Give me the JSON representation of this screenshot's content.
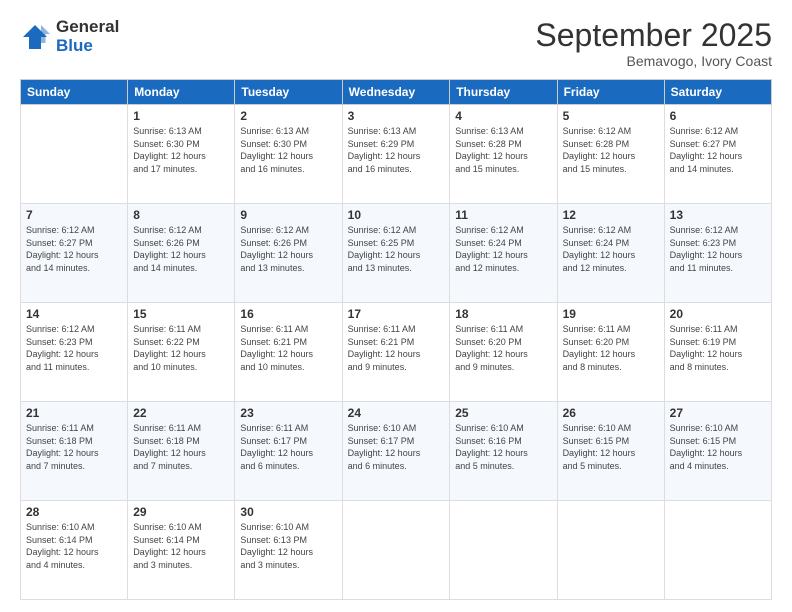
{
  "logo": {
    "general": "General",
    "blue": "Blue"
  },
  "title": "September 2025",
  "subtitle": "Bemavogo, Ivory Coast",
  "days_of_week": [
    "Sunday",
    "Monday",
    "Tuesday",
    "Wednesday",
    "Thursday",
    "Friday",
    "Saturday"
  ],
  "weeks": [
    [
      {
        "day": "",
        "info": ""
      },
      {
        "day": "1",
        "info": "Sunrise: 6:13 AM\nSunset: 6:30 PM\nDaylight: 12 hours\nand 17 minutes."
      },
      {
        "day": "2",
        "info": "Sunrise: 6:13 AM\nSunset: 6:30 PM\nDaylight: 12 hours\nand 16 minutes."
      },
      {
        "day": "3",
        "info": "Sunrise: 6:13 AM\nSunset: 6:29 PM\nDaylight: 12 hours\nand 16 minutes."
      },
      {
        "day": "4",
        "info": "Sunrise: 6:13 AM\nSunset: 6:28 PM\nDaylight: 12 hours\nand 15 minutes."
      },
      {
        "day": "5",
        "info": "Sunrise: 6:12 AM\nSunset: 6:28 PM\nDaylight: 12 hours\nand 15 minutes."
      },
      {
        "day": "6",
        "info": "Sunrise: 6:12 AM\nSunset: 6:27 PM\nDaylight: 12 hours\nand 14 minutes."
      }
    ],
    [
      {
        "day": "7",
        "info": "Sunrise: 6:12 AM\nSunset: 6:27 PM\nDaylight: 12 hours\nand 14 minutes."
      },
      {
        "day": "8",
        "info": "Sunrise: 6:12 AM\nSunset: 6:26 PM\nDaylight: 12 hours\nand 14 minutes."
      },
      {
        "day": "9",
        "info": "Sunrise: 6:12 AM\nSunset: 6:26 PM\nDaylight: 12 hours\nand 13 minutes."
      },
      {
        "day": "10",
        "info": "Sunrise: 6:12 AM\nSunset: 6:25 PM\nDaylight: 12 hours\nand 13 minutes."
      },
      {
        "day": "11",
        "info": "Sunrise: 6:12 AM\nSunset: 6:24 PM\nDaylight: 12 hours\nand 12 minutes."
      },
      {
        "day": "12",
        "info": "Sunrise: 6:12 AM\nSunset: 6:24 PM\nDaylight: 12 hours\nand 12 minutes."
      },
      {
        "day": "13",
        "info": "Sunrise: 6:12 AM\nSunset: 6:23 PM\nDaylight: 12 hours\nand 11 minutes."
      }
    ],
    [
      {
        "day": "14",
        "info": "Sunrise: 6:12 AM\nSunset: 6:23 PM\nDaylight: 12 hours\nand 11 minutes."
      },
      {
        "day": "15",
        "info": "Sunrise: 6:11 AM\nSunset: 6:22 PM\nDaylight: 12 hours\nand 10 minutes."
      },
      {
        "day": "16",
        "info": "Sunrise: 6:11 AM\nSunset: 6:21 PM\nDaylight: 12 hours\nand 10 minutes."
      },
      {
        "day": "17",
        "info": "Sunrise: 6:11 AM\nSunset: 6:21 PM\nDaylight: 12 hours\nand 9 minutes."
      },
      {
        "day": "18",
        "info": "Sunrise: 6:11 AM\nSunset: 6:20 PM\nDaylight: 12 hours\nand 9 minutes."
      },
      {
        "day": "19",
        "info": "Sunrise: 6:11 AM\nSunset: 6:20 PM\nDaylight: 12 hours\nand 8 minutes."
      },
      {
        "day": "20",
        "info": "Sunrise: 6:11 AM\nSunset: 6:19 PM\nDaylight: 12 hours\nand 8 minutes."
      }
    ],
    [
      {
        "day": "21",
        "info": "Sunrise: 6:11 AM\nSunset: 6:18 PM\nDaylight: 12 hours\nand 7 minutes."
      },
      {
        "day": "22",
        "info": "Sunrise: 6:11 AM\nSunset: 6:18 PM\nDaylight: 12 hours\nand 7 minutes."
      },
      {
        "day": "23",
        "info": "Sunrise: 6:11 AM\nSunset: 6:17 PM\nDaylight: 12 hours\nand 6 minutes."
      },
      {
        "day": "24",
        "info": "Sunrise: 6:10 AM\nSunset: 6:17 PM\nDaylight: 12 hours\nand 6 minutes."
      },
      {
        "day": "25",
        "info": "Sunrise: 6:10 AM\nSunset: 6:16 PM\nDaylight: 12 hours\nand 5 minutes."
      },
      {
        "day": "26",
        "info": "Sunrise: 6:10 AM\nSunset: 6:15 PM\nDaylight: 12 hours\nand 5 minutes."
      },
      {
        "day": "27",
        "info": "Sunrise: 6:10 AM\nSunset: 6:15 PM\nDaylight: 12 hours\nand 4 minutes."
      }
    ],
    [
      {
        "day": "28",
        "info": "Sunrise: 6:10 AM\nSunset: 6:14 PM\nDaylight: 12 hours\nand 4 minutes."
      },
      {
        "day": "29",
        "info": "Sunrise: 6:10 AM\nSunset: 6:14 PM\nDaylight: 12 hours\nand 3 minutes."
      },
      {
        "day": "30",
        "info": "Sunrise: 6:10 AM\nSunset: 6:13 PM\nDaylight: 12 hours\nand 3 minutes."
      },
      {
        "day": "",
        "info": ""
      },
      {
        "day": "",
        "info": ""
      },
      {
        "day": "",
        "info": ""
      },
      {
        "day": "",
        "info": ""
      }
    ]
  ]
}
